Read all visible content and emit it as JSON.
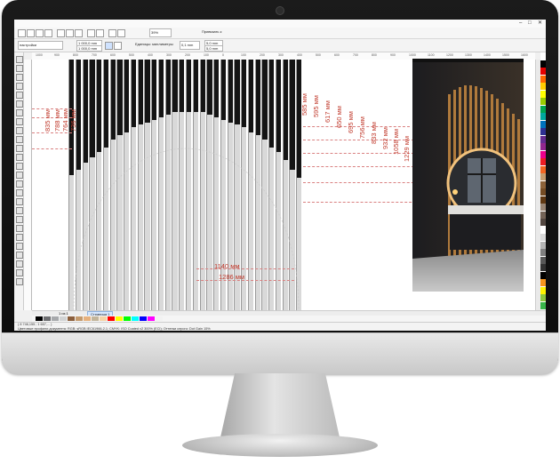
{
  "toolbar": {
    "zoom": "39%",
    "snap": "Привязать к",
    "preset": "настройки",
    "width": "1 000,0 mm",
    "height": "1 000,0 mm",
    "units": "Единицы: миллиметры",
    "nudge": "0,1 mm",
    "dup_x": "5,0 mm",
    "dup_y": "5,0 mm"
  },
  "ruler_ticks": [
    "1000",
    "900",
    "800",
    "700",
    "600",
    "500",
    "400",
    "300",
    "200",
    "100",
    "0",
    "100",
    "200",
    "300",
    "400",
    "500",
    "600",
    "700",
    "800",
    "900",
    "1000",
    "1100",
    "1200",
    "1300",
    "1400",
    "1500",
    "1600"
  ],
  "dimensions": {
    "left": [
      "835 мм",
      "788 мм",
      "764 мм",
      "736 мм"
    ],
    "right": [
      "585 мм",
      "595 мм",
      "617 мм",
      "650 мм",
      "695 мм",
      "756 мм",
      "833 мм",
      "932 мм",
      "1058 мм",
      "1229 мм"
    ],
    "bottom": [
      "1140 мм",
      "1286 мм"
    ]
  },
  "drawing": {
    "stripe_count": 34,
    "dark_lengths": [
      0.46,
      0.44,
      0.41,
      0.39,
      0.37,
      0.35,
      0.32,
      0.3,
      0.29,
      0.27,
      0.26,
      0.25,
      0.24,
      0.23,
      0.22,
      0.21,
      0.21,
      0.21,
      0.21,
      0.21,
      0.22,
      0.23,
      0.24,
      0.25,
      0.26,
      0.27,
      0.29,
      0.3,
      0.32,
      0.35,
      0.37,
      0.4,
      0.44,
      0.47
    ]
  },
  "page": {
    "counter": "1 из 1",
    "tab": "Страница 1"
  },
  "status": {
    "coords": "( 8 746,155 ; 1 657,... )",
    "doc": "Цветовые профили документа: RGB: sRGB IEC61966-2.1; CMYK: ISO Coated v2 300% (ECI); Оттенки серого: Dot Gain 15%"
  },
  "colors": {
    "palette": [
      "#ffffff",
      "#000000",
      "#e60000",
      "#ff6600",
      "#ffcc00",
      "#ffff00",
      "#99cc00",
      "#00a651",
      "#00a99d",
      "#0072bc",
      "#2e3192",
      "#662d91",
      "#92278f",
      "#ec008c",
      "#ed1c24",
      "#f26522",
      "#c69c6d",
      "#8c6239",
      "#754c24",
      "#603913",
      "#998675",
      "#736357",
      "#534741",
      "#ffffff",
      "#d9d9d9",
      "#b3b3b3",
      "#808080",
      "#595959",
      "#333333",
      "#000000",
      "#f7941d",
      "#fff200",
      "#8dc63f",
      "#39b54a"
    ],
    "hpalette": [
      "#000000",
      "#6d6e71",
      "#a7a9ac",
      "#d1d3d4",
      "#8b5e3c",
      "#c49a6c",
      "#e6b17e",
      "#c2b59b",
      "#f5d3a6",
      "#ff0000",
      "#ffff00",
      "#00ff00",
      "#00ffff",
      "#0000ff",
      "#ff00ff",
      "#f2f2f2"
    ]
  },
  "icons": [
    "minimize-icon",
    "maximize-icon",
    "close-icon"
  ]
}
